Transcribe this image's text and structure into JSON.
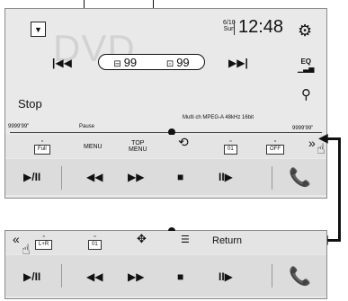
{
  "top": {
    "menu_button_icon": "▼",
    "source_title": "DVD",
    "disc": {
      "title_icon": "⊟",
      "title_num": "99",
      "chapter_icon": "⊡",
      "chapter_num": "99"
    },
    "date_top": "6/10",
    "date_bottom": "Sun",
    "clock": "12:48",
    "settings_icon": "⚙",
    "prev_icon": "|◀◀",
    "next_icon": "▶▶|",
    "eq_label": "EQ",
    "search_icon": "🔍",
    "status": "Stop",
    "elapsed": "9999'99\"",
    "pause_label": "Pause",
    "audio_info": "Multi ch   MPEG-A   48kHz 16bit",
    "remaining": "9999'99\""
  },
  "func1": {
    "aspect": "Full",
    "menu": "MENU",
    "top_menu_1": "TOP",
    "top_menu_2": "MENU",
    "repeat_icon": "⟲",
    "subtitle": "01",
    "off": "OFF",
    "more": "»"
  },
  "func2": {
    "back": "«",
    "lr": "L+R",
    "angle": "01",
    "joystick": "✥",
    "list_icon": "☰",
    "return_label": "Return"
  },
  "transport": {
    "play_pause": "▶/II",
    "rew": "◀◀",
    "ff": "▶▶",
    "stop": "■",
    "slow": "II▶",
    "phone": "📞"
  }
}
